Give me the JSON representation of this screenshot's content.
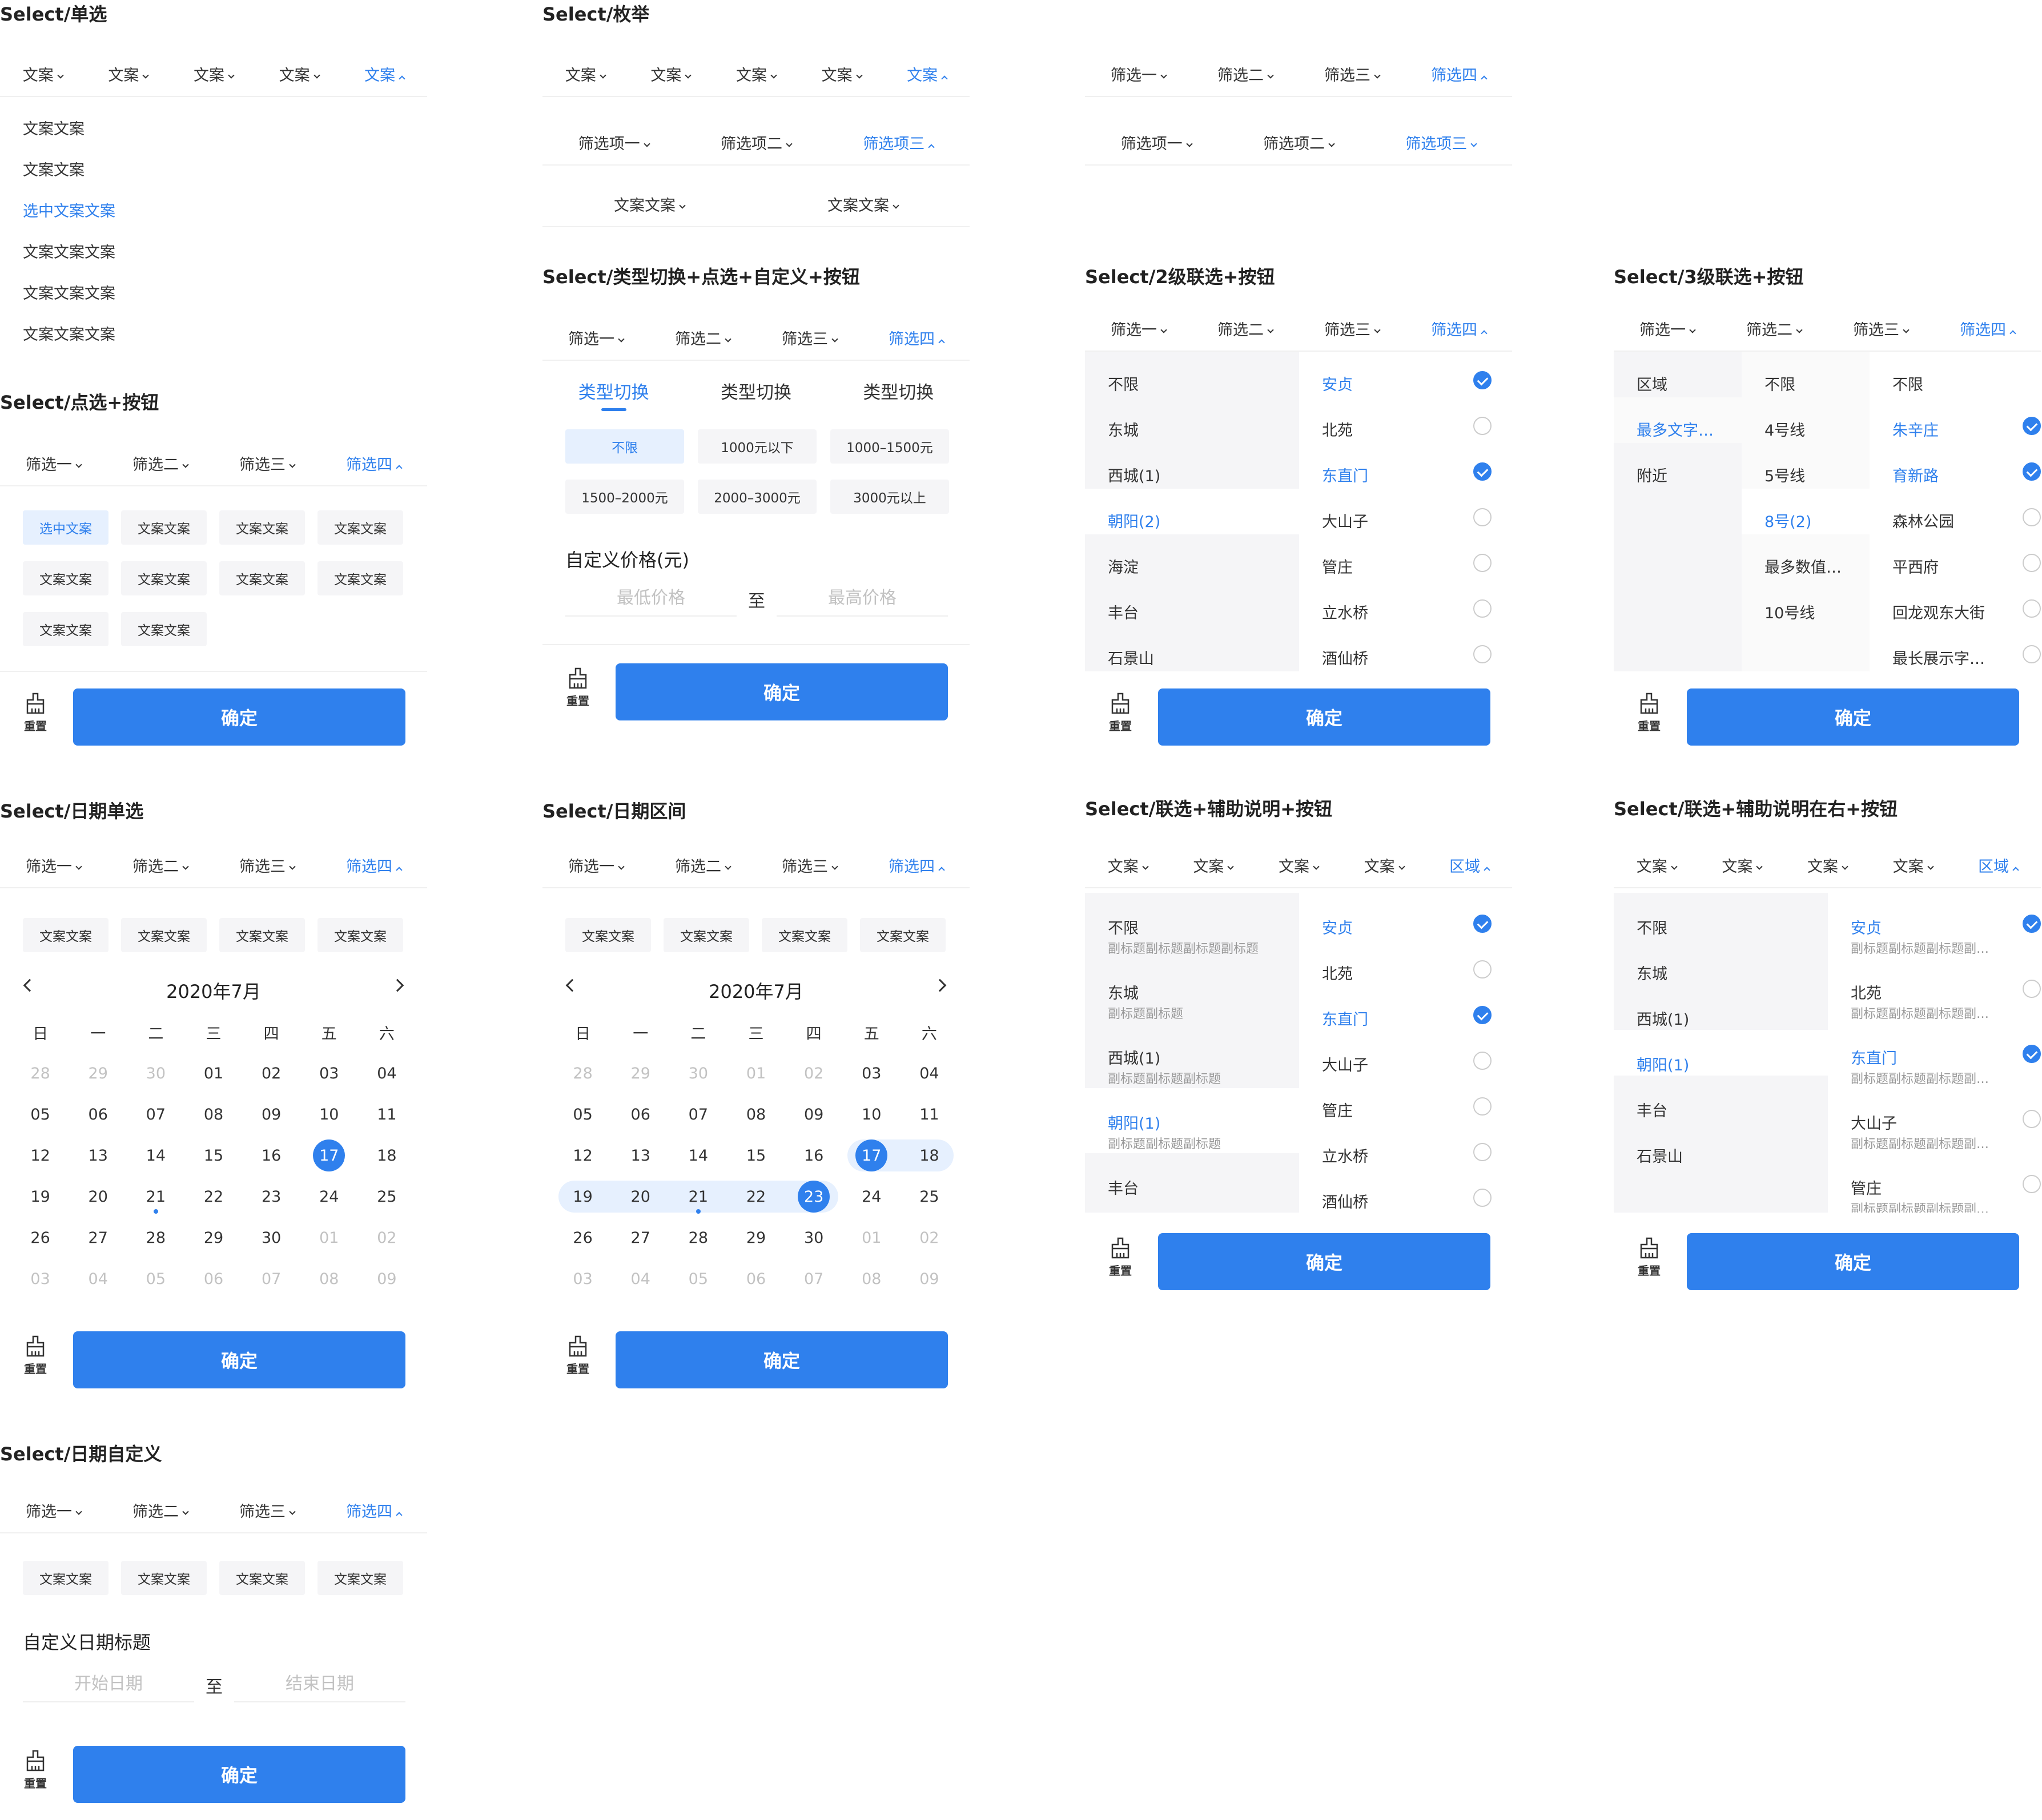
{
  "labels": {
    "reset": "重置",
    "confirm": "确定",
    "to": "至"
  },
  "tabs_generic": [
    "文案",
    "文案",
    "文案",
    "文案",
    "文案"
  ],
  "tabs_filter": [
    "筛选一",
    "筛选二",
    "筛选三",
    "筛选四"
  ],
  "tabs_options": [
    "筛选项一",
    "筛选项二",
    "筛选项三"
  ],
  "tabs_text2": [
    "文案文案",
    "文案文案"
  ],
  "tabs_region": [
    "文案",
    "文案",
    "文案",
    "文案",
    "区域"
  ],
  "p1": {
    "title": "Select/单选",
    "items": [
      "文案文案",
      "文案文案",
      "选中文案文案",
      "文案文案文案",
      "文案文案文案",
      "文案文案文案"
    ]
  },
  "p2": {
    "title": "Select/枚举"
  },
  "p4": {
    "title": "Select/点选+按钮",
    "chips": [
      "选中文案",
      "文案文案",
      "文案文案",
      "文案文案",
      "文案文案",
      "文案文案",
      "文案文案",
      "文案文案",
      "文案文案",
      "文案文案"
    ]
  },
  "p5": {
    "title": "Select/类型切换+点选+自定义+按钮",
    "type_tabs": [
      "类型切换",
      "类型切换",
      "类型切换"
    ],
    "chips": [
      "不限",
      "1000元以下",
      "1000–1500元",
      "1500–2000元",
      "2000–3000元",
      "3000元以上"
    ],
    "custom_label": "自定义价格(元)",
    "min_ph": "最低价格",
    "max_ph": "最高价格"
  },
  "p6": {
    "title": "Select/2级联选+按钮",
    "col1": [
      "不限",
      "东城",
      "西城(1)",
      "朝阳(2)",
      "海淀",
      "丰台",
      "石景山"
    ],
    "col2": [
      "安贞",
      "北苑",
      "东直门",
      "大山子",
      "管庄",
      "立水桥",
      "酒仙桥"
    ]
  },
  "p7": {
    "title": "Select/3级联选+按钮",
    "col1": [
      "区域",
      "最多文字…",
      "附近"
    ],
    "col2": [
      "不限",
      "4号线",
      "5号线",
      "8号(2)",
      "最多数值…",
      "10号线"
    ],
    "col3": [
      "不限",
      "朱辛庄",
      "育新路",
      "森林公园",
      "平西府",
      "回龙观东大街",
      "最长展示字…"
    ]
  },
  "chips4": [
    "文案文案",
    "文案文案",
    "文案文案",
    "文案文案"
  ],
  "cal": {
    "title": "2020年7月",
    "weekdays": [
      "日",
      "一",
      "二",
      "三",
      "四",
      "五",
      "六"
    ],
    "days": [
      "28",
      "29",
      "30",
      "01",
      "02",
      "03",
      "04",
      "05",
      "06",
      "07",
      "08",
      "09",
      "10",
      "11",
      "12",
      "13",
      "14",
      "15",
      "16",
      "17",
      "18",
      "19",
      "20",
      "21",
      "22",
      "23",
      "24",
      "25",
      "26",
      "27",
      "28",
      "29",
      "30",
      "01",
      "02",
      "03",
      "04",
      "05",
      "06",
      "07",
      "08",
      "09"
    ]
  },
  "p8": {
    "title": "Select/日期单选"
  },
  "p9": {
    "title": "Select/日期区间"
  },
  "p10": {
    "title": "Select/联选+辅助说明+按钮",
    "col1": [
      {
        "t": "不限",
        "s": "副标题副标题副标题副标题"
      },
      {
        "t": "东城",
        "s": "副标题副标题"
      },
      {
        "t": "西城(1)",
        "s": "副标题副标题副标题"
      },
      {
        "t": "朝阳(1)",
        "s": "副标题副标题副标题"
      },
      {
        "t": "丰台",
        "s": ""
      }
    ],
    "col2": [
      "安贞",
      "北苑",
      "东直门",
      "大山子",
      "管庄",
      "立水桥",
      "酒仙桥"
    ]
  },
  "p11": {
    "title": "Select/联选+辅助说明在右+按钮",
    "col1": [
      "不限",
      "东城",
      "西城(1)",
      "朝阳(1)",
      "丰台",
      "石景山"
    ],
    "col2": [
      {
        "t": "安贞",
        "s": "副标题副标题副标题副标题..."
      },
      {
        "t": "北苑",
        "s": "副标题副标题副标题副标题..."
      },
      {
        "t": "东直门",
        "s": "副标题副标题副标题副标题..."
      },
      {
        "t": "大山子",
        "s": "副标题副标题副标题副标题..."
      },
      {
        "t": "管庄",
        "s": "副标题副标题副标题副标题..."
      }
    ]
  },
  "p12": {
    "title": "Select/日期自定义",
    "custom_label": "自定义日期标题",
    "start_ph": "开始日期",
    "end_ph": "结束日期"
  }
}
